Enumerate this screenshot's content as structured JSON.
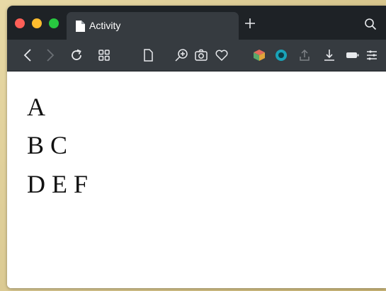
{
  "tab": {
    "title": "Activity"
  },
  "toolbar": {
    "icons": [
      "back-icon",
      "forward-icon",
      "reload-icon",
      "grid-icon",
      "page-icon",
      "zoom-in-icon",
      "camera-icon",
      "heart-icon",
      "cube-icon",
      "circle-icon",
      "share-icon",
      "download-icon",
      "battery-icon",
      "menu-icon"
    ]
  },
  "content": {
    "lines": [
      "A",
      "B C",
      "D E F"
    ]
  },
  "colors": {
    "titlebar": "#1e2226",
    "toolbar": "#363b40",
    "close": "#fe5f57",
    "minimize": "#febc2e",
    "maximize": "#28c840"
  }
}
